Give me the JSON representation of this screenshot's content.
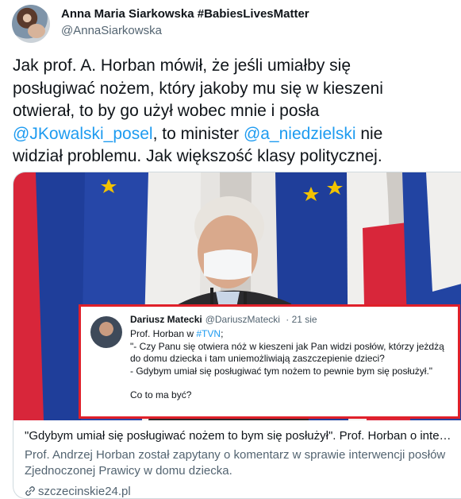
{
  "author": {
    "display_name": "Anna Maria Siarkowska #BabiesLivesMatter",
    "handle": "@AnnaSiarkowska"
  },
  "tweet": {
    "line1": "Jak prof. A. Horban mówił, że jeśli umiałby się",
    "line2": "posługiwać nożem, który jakoby mu się w kieszeni",
    "line3": "otwierał, to by go użył wobec mnie i posła",
    "mention1": "@JKowalski_posel",
    "mid4": ", to minister ",
    "mention2": "@a_niedzielski",
    "end4": " nie",
    "line5": "widział problemu. Jak większość klasy politycznej."
  },
  "embedded_tweet": {
    "name": "Dariusz Matecki",
    "handle": "@DariuszMatecki",
    "date": "· 21 sie",
    "prefix": "Prof. Horban w ",
    "tag": "#TVN",
    "suffix": ";",
    "q1": "\"- Czy Panu się otwiera nóż w kieszeni jak Pan widzi posłów, którzy jeżdżą",
    "q2": "do domu dziecka i tam uniemożliwiają zaszczepienie dzieci?",
    "q3": " - Gdybym umiał się posługiwać tym nożem to pewnie bym się posłużył.\"",
    "q4": "Co to ma być?"
  },
  "card": {
    "title": "\"Gdybym umiał się posługiwać nożem to bym się posłużył\". Prof. Horban o inter…",
    "description": "Prof. Andrzej Horban został zapytany o komentarz w sprawie interwencji posłów Zjednoczonej Prawicy w domu dziecka.",
    "domain": "szczecinskie24.pl"
  },
  "colors": {
    "link": "#1d9bf0",
    "text": "#0f1419",
    "muted": "#536471",
    "highlight_border": "#e0202a",
    "eu_blue": "#1f3e9a",
    "poland_red": "#d8263a"
  },
  "icons": [
    "link-icon"
  ]
}
